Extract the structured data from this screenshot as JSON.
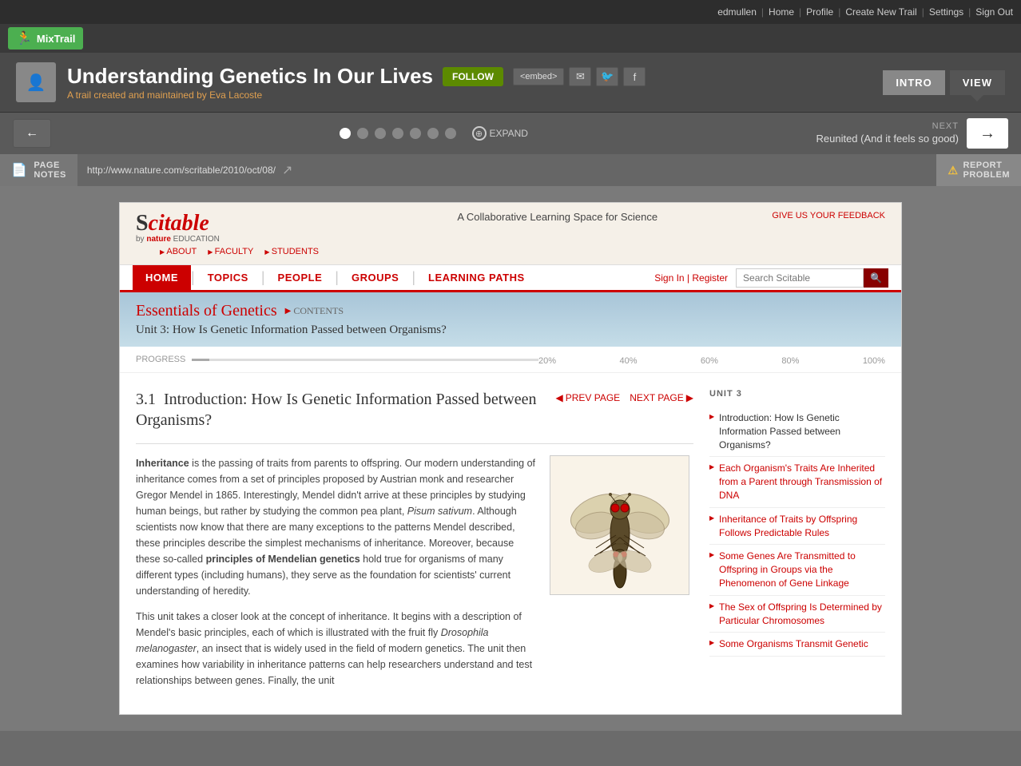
{
  "top_nav": {
    "user": "edmullen",
    "links": [
      "Home",
      "Profile",
      "Create New Trail",
      "Settings",
      "Sign Out"
    ]
  },
  "mixtrail": {
    "logo": "MixTrail",
    "runner_icon": "🏃"
  },
  "header": {
    "trail_title": "Understanding Genetics In Our Lives",
    "follow_label": "FOLLOW",
    "trail_subtitle": "A trail created and maintained by",
    "author": "Eva Lacoste",
    "embed_label": "<embed>",
    "intro_label": "INTRO",
    "view_label": "VIEW"
  },
  "nav_bar": {
    "back_icon": "←",
    "dots": [
      1,
      2,
      3,
      4,
      5,
      6,
      7
    ],
    "active_dot": 0,
    "expand_label": "EXPAND",
    "next_label": "NEXT",
    "next_title": "Reunited (And it feels so good)",
    "next_icon": "→"
  },
  "page_notes": {
    "label": "PAGE\nNOTES",
    "url": "http://www.nature.com/scritable/2010/oct/08/",
    "report_label": "REPORT\nPROBLEM"
  },
  "scitable": {
    "logo": "Scitable",
    "tagline": "A Collaborative Learning Space for Science",
    "by_nature": "by nature EDUCATION",
    "nav_links": [
      "ABOUT",
      "FACULTY",
      "STUDENTS"
    ],
    "feedback": "GIVE US YOUR FEEDBACK",
    "sign_in": "Sign In | Register",
    "search_placeholder": "Search Scitable",
    "main_nav": [
      "HOME",
      "TOPICS",
      "PEOPLE",
      "GROUPS",
      "LEARNING PATHS"
    ],
    "essentials_title": "Essentials of Genetics",
    "contents_label": "CONTENTS",
    "unit_title": "Unit 3: How Is Genetic Information Passed between Organisms?",
    "progress_label": "PROGRESS",
    "progress_markers": [
      "20%",
      "40%",
      "60%",
      "80%",
      "100%"
    ],
    "article": {
      "section": "3.1",
      "title": "Introduction: How Is Genetic Information Passed between Organisms?",
      "prev_label": "PREV PAGE",
      "next_label": "NEXT PAGE",
      "paragraph1": "Inheritance is the passing of traits from parents to offspring. Our modern understanding of inheritance comes from a set of principles proposed by Austrian monk and researcher Gregor Mendel in 1865. Interestingly, Mendel didn't arrive at these principles by studying human beings, but rather by studying the common pea plant, Pisum sativum. Although scientists now know that there are many exceptions to the patterns Mendel described, these principles describe the simplest mechanisms of inheritance. Moreover, because these so-called principles of Mendelian genetics hold true for organisms of many different types (including humans), they serve as the foundation for scientists' current understanding of heredity.",
      "paragraph2": "This unit takes a closer look at the concept of inheritance. It begins with a description of Mendel's basic principles, each of which is illustrated with the fruit fly Drosophila melanogaster, an insect that is widely used in the field of modern genetics. The unit then examines how variability in inheritance patterns can help researchers understand and test relationships between genes. Finally, the unit"
    },
    "sidebar": {
      "unit_label": "UNIT 3",
      "items": [
        "Introduction: How Is Genetic Information Passed between Organisms?",
        "Each Organism's Traits Are Inherited from a Parent through Transmission of DNA",
        "Inheritance of Traits by Offspring Follows Predictable Rules",
        "Some Genes Are Transmitted to Offspring in Groups via the Phenomenon of Gene Linkage",
        "The Sex of Offspring Is Determined by Particular Chromosomes",
        "Some Organisms Transmit Genetic"
      ]
    }
  }
}
